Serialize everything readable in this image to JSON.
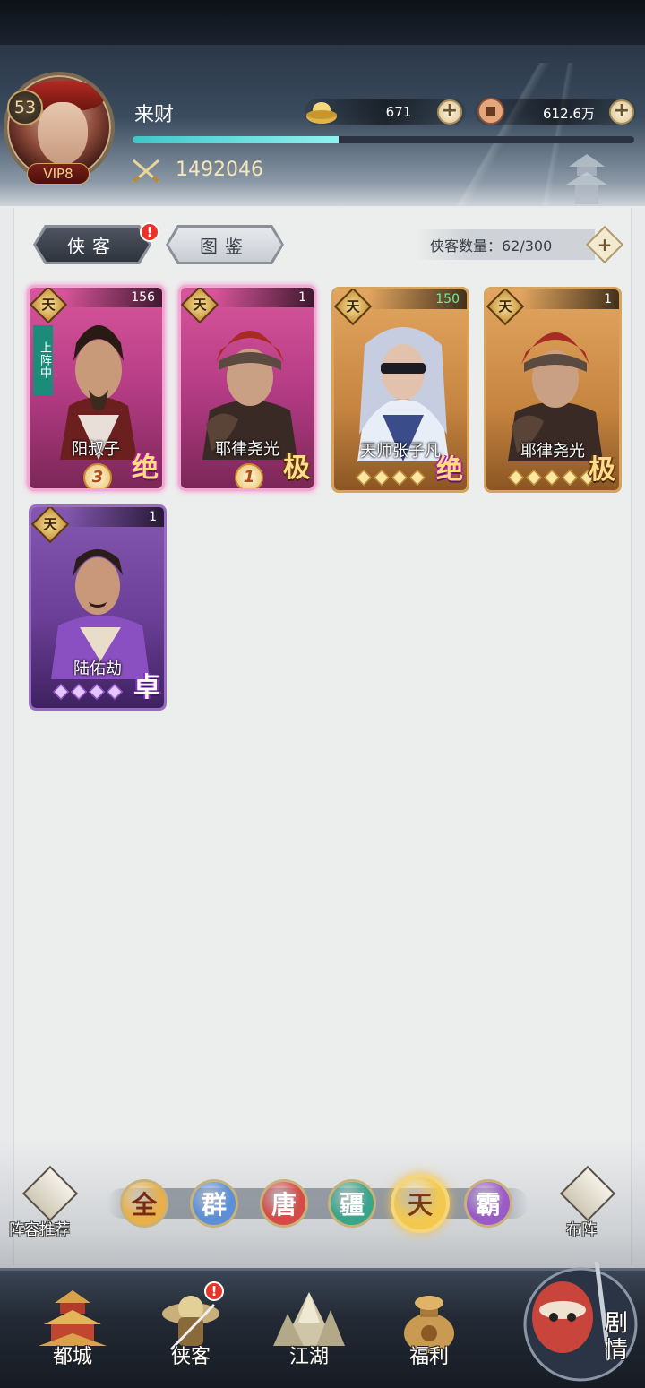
{
  "player": {
    "level": "53",
    "vip": "VIP8",
    "name": "来财",
    "exp_progress": 0.41,
    "power": "1492046"
  },
  "currencies": {
    "gold_ingot": "671",
    "copper_coin": "612.6万",
    "add_symbol": "+"
  },
  "tabs": {
    "heroes": "侠客",
    "codex": "图鉴",
    "alert": "!"
  },
  "hero_count": {
    "label": "侠客数量：62/300",
    "add_symbol": "+"
  },
  "heroes": [
    {
      "tier": "天",
      "level": "156",
      "name": "阳叔子",
      "in_lineup": "上阵中",
      "rank": "3",
      "rarity": "绝",
      "color": "pink",
      "stars": 0
    },
    {
      "tier": "天",
      "level": "1",
      "name": "耶律尧光",
      "rank": "1",
      "rarity": "极",
      "color": "pink",
      "stars": 0
    },
    {
      "tier": "天",
      "level": "150",
      "name": "天师张子凡",
      "rarity": "绝",
      "color": "gold",
      "stars": 4
    },
    {
      "tier": "天",
      "level": "1",
      "name": "耶律尧光",
      "rarity": "极",
      "color": "gold",
      "stars": 5
    },
    {
      "tier": "天",
      "level": "1",
      "name": "陆佑劫",
      "rarity": "卓",
      "color": "purple",
      "stars": 4
    }
  ],
  "side_buttons": {
    "recommend": "阵容推荐",
    "formation": "布阵"
  },
  "factions": [
    {
      "label": "全",
      "color": "#e9b04a",
      "text_color": "#7a2a10",
      "active": false
    },
    {
      "label": "群",
      "color": "#5b8fd8",
      "text_color": "#ffffff",
      "active": false
    },
    {
      "label": "唐",
      "color": "#d64a48",
      "text_color": "#ffffff",
      "active": false
    },
    {
      "label": "疆",
      "color": "#3aa58a",
      "text_color": "#ffffff",
      "active": false
    },
    {
      "label": "天",
      "color": "#f3c84f",
      "text_color": "#7a3a10",
      "active": true
    },
    {
      "label": "霸",
      "color": "#9a5ac8",
      "text_color": "#ffffff",
      "active": false
    }
  ],
  "bottom_nav": {
    "capital": "都城",
    "heroes": "侠客",
    "jianghu": "江湖",
    "welfare": "福利",
    "story": "剧情",
    "alert": "!"
  },
  "colors": {
    "exp_fill": "#3fc6c6",
    "alert": "#e8332b"
  }
}
